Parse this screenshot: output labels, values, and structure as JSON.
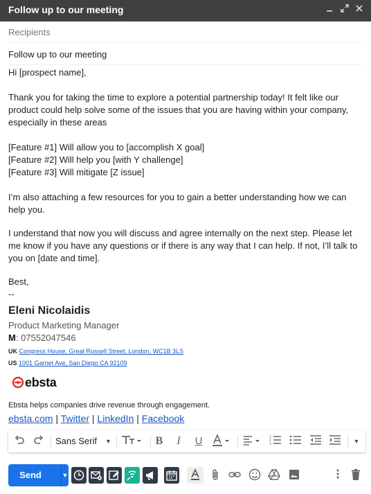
{
  "window": {
    "title": "Follow up to our meeting"
  },
  "fields": {
    "recipients_placeholder": "Recipients",
    "subject": "Follow up to our meeting"
  },
  "body": {
    "greeting": "Hi [prospect name],",
    "para1": "Thank you for taking the time to explore a potential partnership today! It felt like our product could help solve some of the issues that you are having within your company, especially in these areas",
    "features": [
      "[Feature #1] Will allow you to [accomplish X goal]",
      "[Feature #2] Will help you [with Y challenge]",
      "[Feature #3] Will mitigate [Z issue]"
    ],
    "para2": "I’m also attaching a few resources for you to gain a better understanding how we can help you.",
    "para3": "I understand that now you will discuss and agree internally on the next step. Please let me know if you have any questions or if there is any way that I can help. If not, I’ll talk to you on [date and time].",
    "closing": "Best,",
    "dashes": "--"
  },
  "signature": {
    "name": "Eleni Nicolaidis",
    "role": "Product Marketing Manager",
    "phone_prefix": "M",
    "phone": ": 07552047546",
    "uk_label": "UK",
    "uk_address": "Congress House, Great Russell Street, London, WC1B 3LS",
    "us_label": "US",
    "us_address": "1001 Garnet Ave, San Diego CA 92109",
    "logo_text": "ebsta",
    "tagline": "Ebsta helps companies drive revenue through engagement.",
    "links": [
      "ebsta.com",
      "Twitter",
      "LinkedIn",
      "Facebook"
    ],
    "link_separator": " | "
  },
  "format_bar": {
    "font": "Sans Serif"
  },
  "bottom_bar": {
    "send_label": "Send"
  },
  "colors": {
    "titlebar": "#404040",
    "send": "#1a73e8",
    "link": "#1a56c4",
    "logo_red": "#e4322b",
    "extension_dark": "#2f3a46",
    "extension_green": "#1ab394"
  }
}
